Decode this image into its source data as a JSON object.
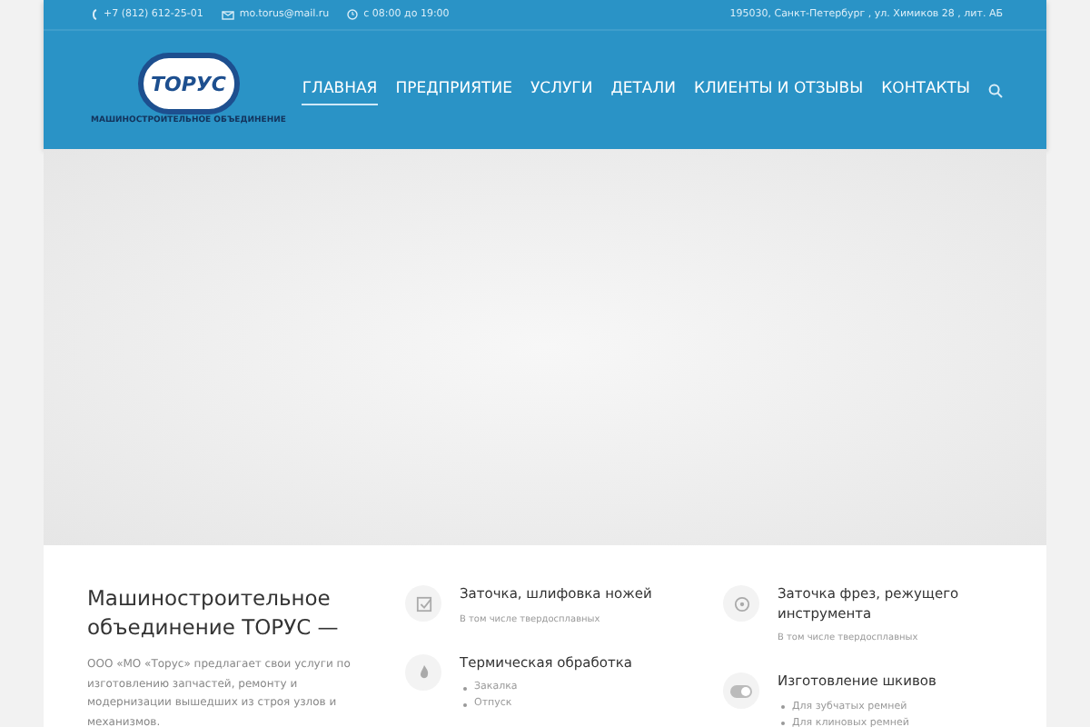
{
  "topbar": {
    "phone": "+7 (812) 612-25-01",
    "email": "mo.torus@mail.ru",
    "hours": "с 08:00 до 19:00",
    "address": "195030, Санкт-Петербург , ул. Химиков 28 , лит. АБ"
  },
  "logo": {
    "text": "ТОРУС",
    "subtitle": "МАШИНОСТРОИТЕЛЬНОЕ ОБЪЕДИНЕНИЕ"
  },
  "nav": [
    {
      "label": "ГЛАВНАЯ",
      "selected": true
    },
    {
      "label": "ПРЕДПРИЯТИЕ",
      "selected": false
    },
    {
      "label": "УСЛУГИ",
      "selected": false
    },
    {
      "label": "ДЕТАЛИ",
      "selected": false
    },
    {
      "label": "КЛИЕНТЫ И ОТЗЫВЫ",
      "selected": false
    },
    {
      "label": "КОНТАКТЫ",
      "selected": false
    }
  ],
  "intro": {
    "title": "Машиностроительное объединение ТОРУС —",
    "text": "ООО «МО «Торус» предлагает свои услуги по изготовлению запчастей, ремонту и модернизации вышедших из строя узлов и механизмов."
  },
  "services": [
    {
      "kind": "check",
      "title": "Заточка, шлифовка ножей",
      "note": "В том числе твердосплавных"
    },
    {
      "kind": "disc",
      "title": "Заточка фрез, режущего инструмента",
      "note": "В том числе твердосплавных"
    },
    {
      "kind": "flame",
      "title": "Термическая обработка",
      "bullets": [
        "Закалка",
        "Отпуск"
      ]
    },
    {
      "kind": "toggle",
      "title": "Изготовление шкивов",
      "bullets": [
        "Для зубчатых ремней",
        "Для клиновых ремней"
      ]
    }
  ]
}
